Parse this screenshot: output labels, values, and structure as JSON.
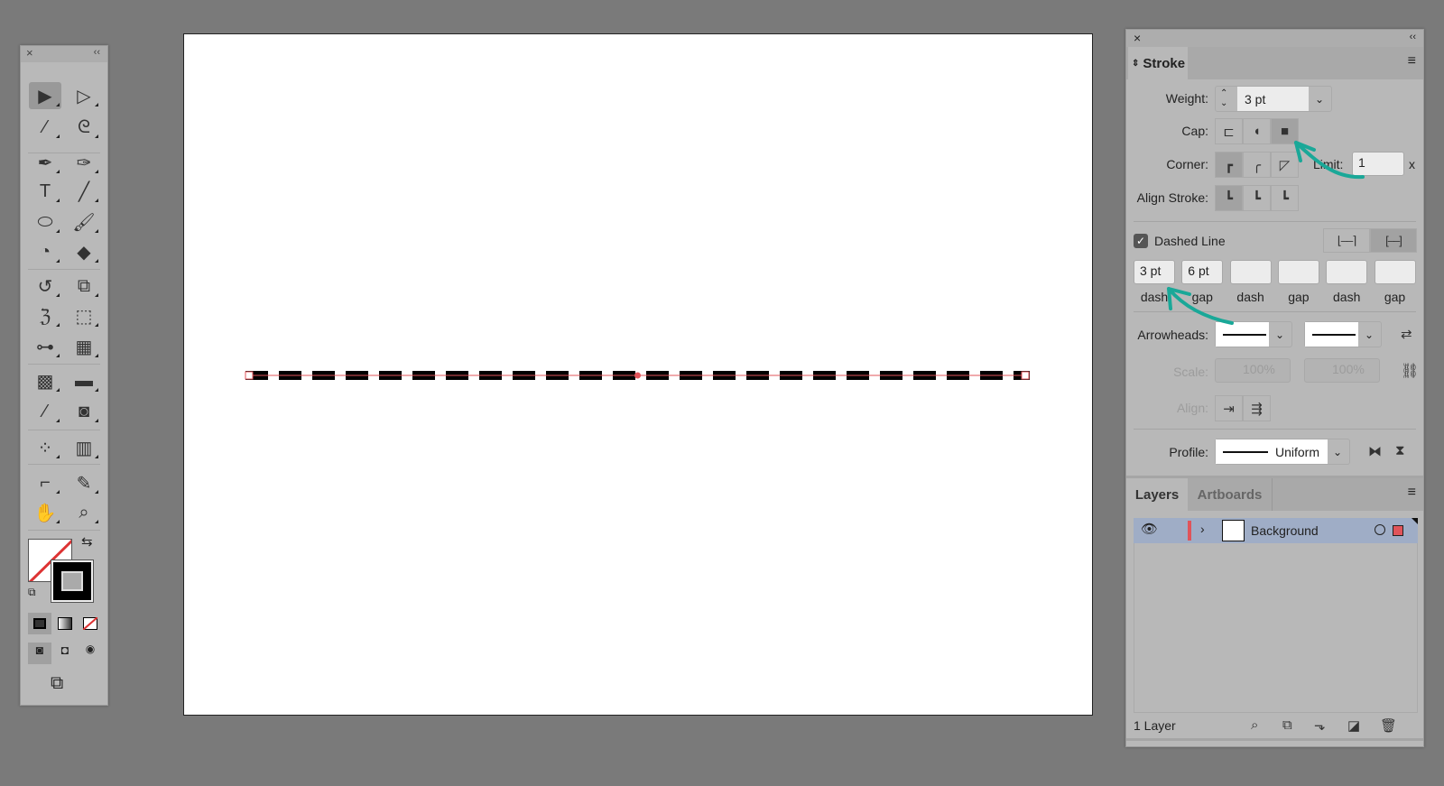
{
  "toolbar": {
    "close": "×",
    "collapse": "‹‹",
    "tools": [
      {
        "icon": "selection-tool-icon",
        "glyph": "▶",
        "col": 0,
        "row": 0,
        "selected": true
      },
      {
        "icon": "direct-selection-tool-icon",
        "glyph": "▷",
        "col": 1,
        "row": 0
      },
      {
        "icon": "magic-wand-tool-icon",
        "glyph": "⁄",
        "col": 0,
        "row": 1
      },
      {
        "icon": "lasso-tool-icon",
        "glyph": "ᘓ",
        "col": 1,
        "row": 1
      },
      {
        "icon": "pen-tool-icon",
        "glyph": "✒",
        "col": 0,
        "row": 2
      },
      {
        "icon": "curvature-tool-icon",
        "glyph": "✑",
        "col": 1,
        "row": 2
      },
      {
        "icon": "type-tool-icon",
        "glyph": "T",
        "col": 0,
        "row": 3
      },
      {
        "icon": "line-segment-tool-icon",
        "glyph": "╱",
        "col": 1,
        "row": 3
      },
      {
        "icon": "ellipse-tool-icon",
        "glyph": "⬭",
        "col": 0,
        "row": 4
      },
      {
        "icon": "paintbrush-tool-icon",
        "glyph": "🖌",
        "col": 1,
        "row": 4
      },
      {
        "icon": "shaper-tool-icon",
        "glyph": "◔",
        "col": 0,
        "row": 5
      },
      {
        "icon": "eraser-tool-icon",
        "glyph": "◆",
        "col": 1,
        "row": 5
      },
      {
        "icon": "rotate-tool-icon",
        "glyph": "↺",
        "col": 0,
        "row": 6
      },
      {
        "icon": "scale-tool-icon",
        "glyph": "⧉",
        "col": 1,
        "row": 6
      },
      {
        "icon": "warp-tool-icon",
        "glyph": "ℨ",
        "col": 0,
        "row": 7
      },
      {
        "icon": "free-transform-tool-icon",
        "glyph": "⬚",
        "col": 1,
        "row": 7
      },
      {
        "icon": "shape-builder-tool-icon",
        "glyph": "⊶",
        "col": 0,
        "row": 8
      },
      {
        "icon": "perspective-grid-tool-icon",
        "glyph": "▦",
        "col": 1,
        "row": 8
      },
      {
        "icon": "mesh-tool-icon",
        "glyph": "▩",
        "col": 0,
        "row": 9
      },
      {
        "icon": "gradient-tool-icon",
        "glyph": "▬",
        "col": 1,
        "row": 9
      },
      {
        "icon": "eyedropper-tool-icon",
        "glyph": "⁄",
        "col": 0,
        "row": 10
      },
      {
        "icon": "blend-tool-icon",
        "glyph": "◙",
        "col": 1,
        "row": 10
      },
      {
        "icon": "symbol-sprayer-tool-icon",
        "glyph": "⁘",
        "col": 0,
        "row": 11
      },
      {
        "icon": "column-graph-tool-icon",
        "glyph": "▥",
        "col": 1,
        "row": 11
      },
      {
        "icon": "artboard-tool-icon",
        "glyph": "⌐",
        "col": 0,
        "row": 12
      },
      {
        "icon": "slice-tool-icon",
        "glyph": "✎",
        "col": 1,
        "row": 12
      },
      {
        "icon": "hand-tool-icon",
        "glyph": "✋",
        "col": 0,
        "row": 13
      },
      {
        "icon": "zoom-tool-icon",
        "glyph": "⌕",
        "col": 1,
        "row": 13
      }
    ]
  },
  "canvas": {
    "stroke_color": "#000000",
    "path_color": "#e0545a"
  },
  "stroke_panel": {
    "close": "×",
    "collapse": "‹‹",
    "tab_label": "Stroke",
    "weight_label": "Weight:",
    "weight_value": "3 pt",
    "cap_label": "Cap:",
    "cap_selected": "projecting",
    "corner_label": "Corner:",
    "corner_selected": "miter",
    "limit_label": "Limit:",
    "limit_value": "1",
    "limit_unit": "x",
    "align_label": "Align Stroke:",
    "dashed_label": "Dashed Line",
    "dashed_checked": true,
    "dash_fields": [
      {
        "value": "3 pt",
        "label": "dash"
      },
      {
        "value": "6 pt",
        "label": "gap"
      },
      {
        "value": "",
        "label": "dash"
      },
      {
        "value": "",
        "label": "gap"
      },
      {
        "value": "",
        "label": "dash"
      },
      {
        "value": "",
        "label": "gap"
      }
    ],
    "arrowheads_label": "Arrowheads:",
    "scale_label": "Scale:",
    "scale_start": "100%",
    "scale_end": "100%",
    "align_arrow_label": "Align:",
    "profile_label": "Profile:",
    "profile_value": "Uniform",
    "annotation_color": "#1aa898"
  },
  "layers_panel": {
    "tabs": [
      "Layers",
      "Artboards"
    ],
    "layers": [
      {
        "name": "Background",
        "color": "#e0545a"
      }
    ],
    "count": "1 Layer"
  }
}
